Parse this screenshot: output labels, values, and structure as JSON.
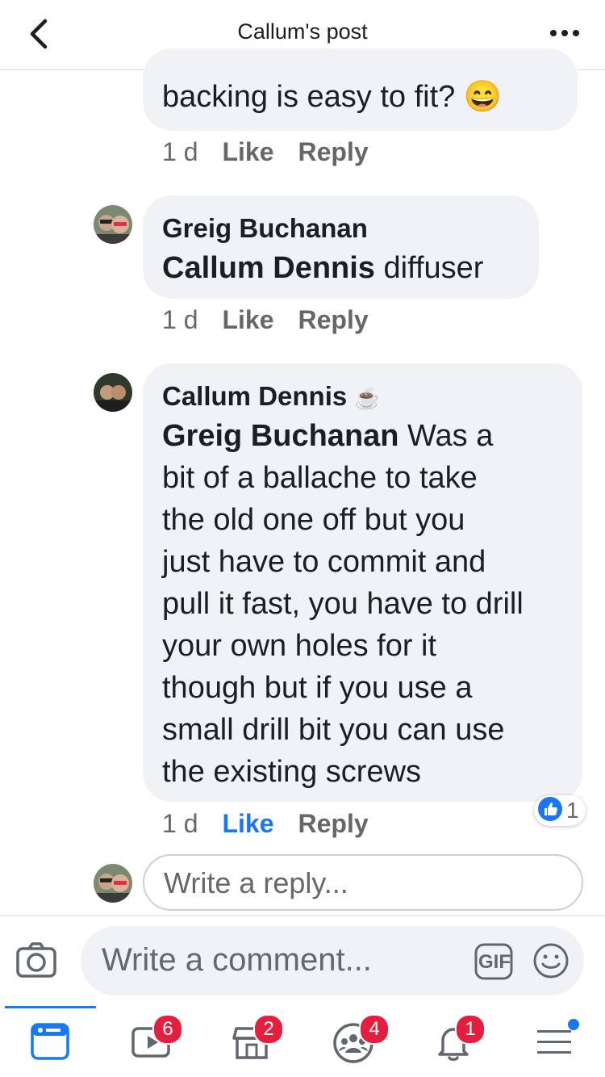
{
  "header": {
    "title": "Callum's post"
  },
  "comments": {
    "partial": {
      "text": "backing is easy to fit? 😄",
      "time": "1 d",
      "like": "Like",
      "reply": "Reply"
    },
    "greig": {
      "author": "Greig Buchanan",
      "mention": "Callum Dennis",
      "text": " diffuser",
      "time": "1 d",
      "like": "Like",
      "reply": "Reply"
    },
    "callum": {
      "author": "Callum Dennis",
      "author_emoji": "☕",
      "mention": "Greig Buchanan",
      "line1": " Was a",
      "lines": [
        "bit of a ballache to take",
        "the old one off but you",
        "just have to commit and",
        "pull it fast, you have to drill",
        "your own holes for it",
        "though but if you use a",
        "small drill bit you can use",
        "the existing screws"
      ],
      "time": "1 d",
      "like": "Like",
      "reply": "Reply",
      "reaction_count": "1"
    }
  },
  "reply_box": {
    "placeholder": "Write a reply..."
  },
  "composer": {
    "placeholder": "Write a comment...",
    "gif_label": "GIF"
  },
  "nav": {
    "items": [
      {
        "name": "news-feed",
        "badge": ""
      },
      {
        "name": "watch",
        "badge": "6"
      },
      {
        "name": "marketplace",
        "badge": "2"
      },
      {
        "name": "groups",
        "badge": "4"
      },
      {
        "name": "notifications",
        "badge": "1"
      },
      {
        "name": "menu",
        "badge": ""
      }
    ]
  },
  "colors": {
    "accent": "#1877f2",
    "badge": "#e41e3f",
    "bubble": "#f0f2f5"
  }
}
